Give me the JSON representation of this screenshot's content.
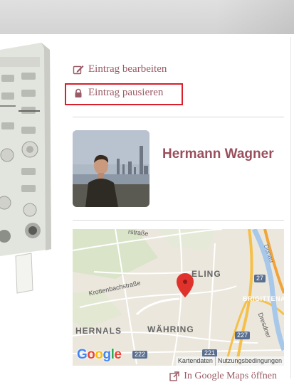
{
  "actions": {
    "edit_label": "Eintrag bearbeiten",
    "edit_icon": "edit-icon",
    "pause_label": "Eintrag pausieren",
    "pause_icon": "lock-icon"
  },
  "owner": {
    "name": "Hermann Wagner"
  },
  "map": {
    "labels": {
      "street1": "rstraße",
      "elling": "ELING",
      "krotten": "Krottenbachstraße",
      "brigitt": "BRIGITTENAU",
      "dresdner": "Dresdner",
      "donau": "Donau",
      "hernals": "HERNALS",
      "wahring": "WÄHRING"
    },
    "shields": {
      "s227": "227",
      "s222": "222",
      "s221": "221",
      "s27": "27"
    },
    "google": [
      "G",
      "o",
      "o",
      "g",
      "l",
      "e"
    ],
    "attribution": {
      "map_data": "Kartendaten",
      "terms": "Nutzungsbedingungen"
    }
  },
  "maps_link": {
    "label": "In Google Maps öffnen",
    "icon": "external-link-icon"
  },
  "colors": {
    "accent": "#9a5a66",
    "name": "#9a4f5c",
    "highlight": "#d81f2a",
    "marker": "#e0322d"
  }
}
